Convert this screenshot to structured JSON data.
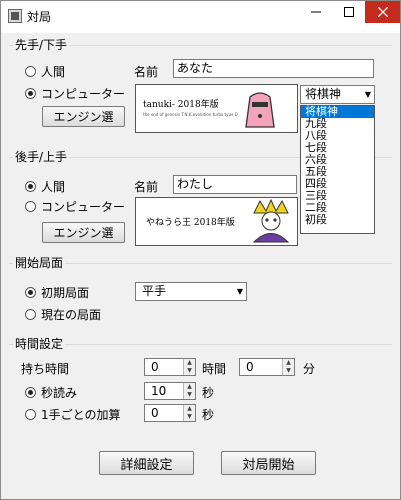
{
  "window": {
    "title": "対局",
    "icon": "app-icon"
  },
  "sente": {
    "group_label": "先手/下手",
    "human_label": "人間",
    "computer_label": "コンピューター",
    "selected": "computer",
    "engine_button": "エンジン選",
    "name_label": "名前",
    "name_value": "あなた",
    "banner_text": "tanuki- 2018年版",
    "banner_sub": "the end of genesis T.N.K.evolution turbo type D",
    "level_select": "将棋神"
  },
  "gote": {
    "group_label": "後手/上手",
    "human_label": "人間",
    "computer_label": "コンピューター",
    "selected": "human",
    "engine_button": "エンジン選",
    "name_label": "名前",
    "name_value": "わたし",
    "banner_text": "やねうら王 2018年版"
  },
  "dropdown": {
    "items": [
      "将棋神",
      "九段",
      "八段",
      "七段",
      "六段",
      "五段",
      "四段",
      "三段",
      "二段",
      "初段"
    ],
    "selected_index": 0
  },
  "start_position": {
    "group_label": "開始局面",
    "initial_label": "初期局面",
    "current_label": "現在の局面",
    "selected": "initial",
    "handicap_select": "平手"
  },
  "time": {
    "group_label": "時間設定",
    "time_label": "持ち時間",
    "hours_value": "0",
    "hours_unit": "時間",
    "minutes_value": "0",
    "minutes_unit": "分",
    "byoyomi_label": "秒読み",
    "byoyomi_value": "10",
    "byoyomi_unit": "秒",
    "increment_label": "1手ごとの加算",
    "increment_value": "0",
    "increment_unit": "秒",
    "selected": "byoyomi"
  },
  "buttons": {
    "detail": "詳細設定",
    "start": "対局開始"
  }
}
